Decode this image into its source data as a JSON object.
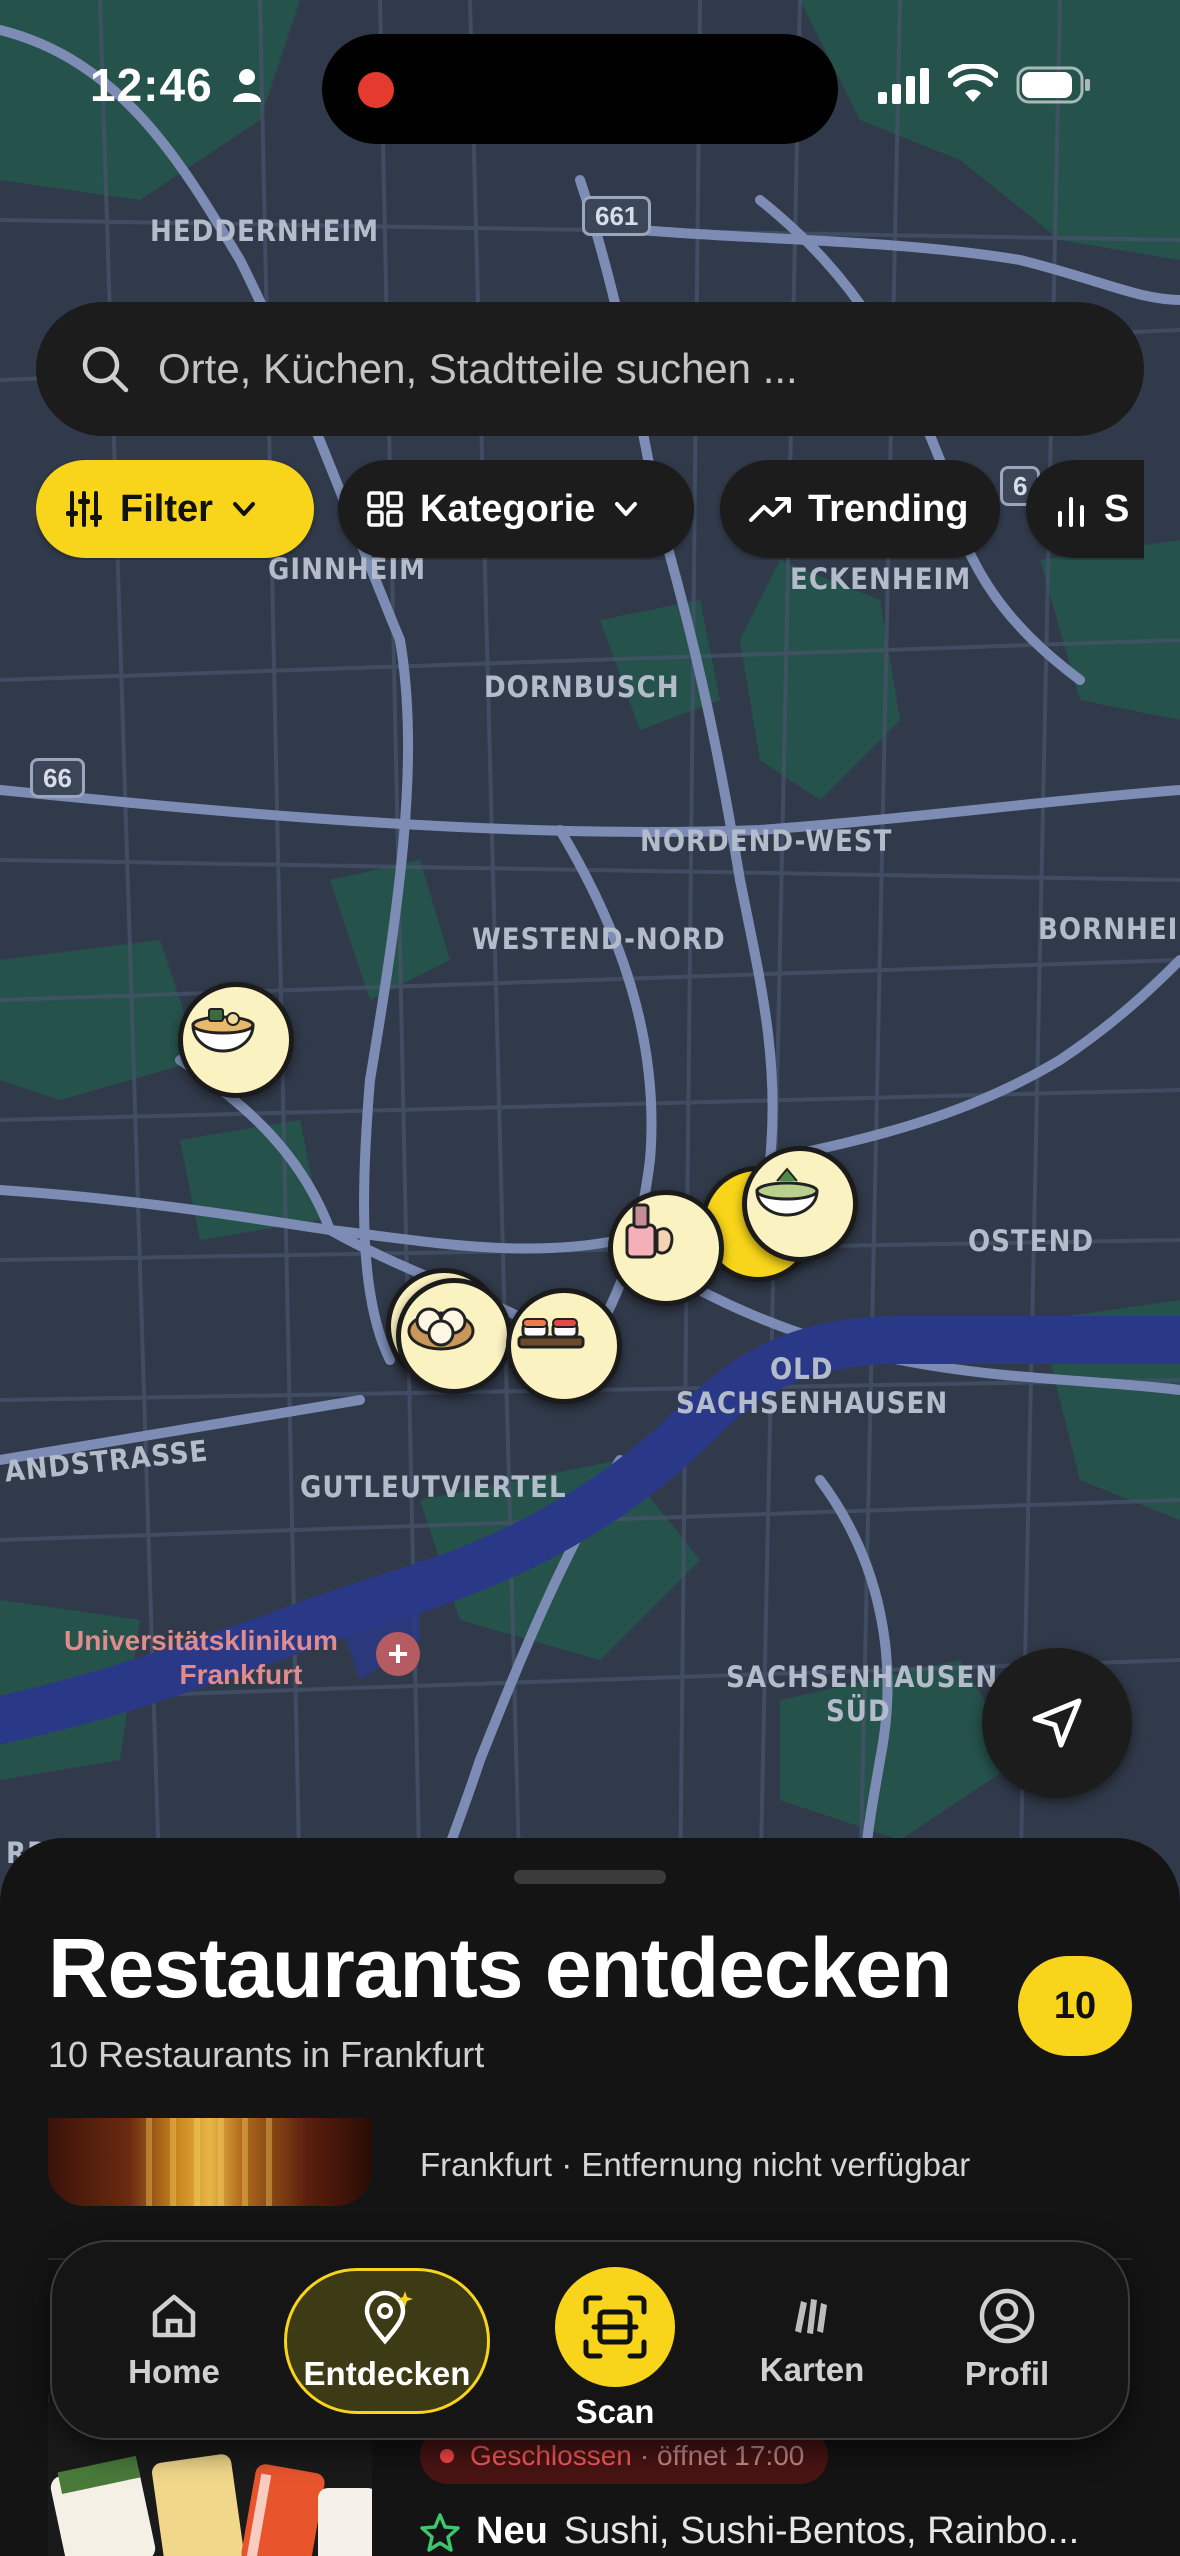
{
  "status_bar": {
    "time": "12:46"
  },
  "map": {
    "road_shields": [
      "661",
      "66",
      "6"
    ],
    "districts": [
      "HEDDERNHEIM",
      "GINNHEIM",
      "ECKENHEIM",
      "DORNBUSCH",
      "NORDEND-WEST",
      "WESTEND-NORD",
      "BORNHEIM",
      "OSTEND",
      "OLD",
      "SACHSENHAUSEN",
      "GUTLEUTVIERTEL",
      "SACHSENHAUSEN-",
      "SÜD",
      "ANDSTRASSE",
      "RR"
    ],
    "clinic_label_1": "Universitätsklinikum",
    "clinic_label_2": "Frankfurt",
    "pins": [
      "ramen-pin-icon",
      "nail-polish-pin-icon",
      "noodle-bowl-pin-icon",
      "dumpling-basket-pin-icon",
      "sushi-pin-icon"
    ]
  },
  "search": {
    "placeholder": "Orte, Küchen, Stadtteile suchen ..."
  },
  "chips": {
    "filter": "Filter",
    "kategorie": "Kategorie",
    "trending": "Trending",
    "sort": "S"
  },
  "sheet": {
    "title": "Restaurants entdecken",
    "subtitle": "10 Restaurants in Frankfurt",
    "count": "10",
    "card1": {
      "meta": "Frankfurt · Entfernung nicht verfügbar"
    },
    "card2": {
      "status": "Geschlossen",
      "status_sub": "· öffnet 17:00",
      "badge": "Neu",
      "tags": "Sushi, Sushi-Bentos, Rainbo..."
    }
  },
  "tabbar": {
    "home": "Home",
    "entdecken": "Entdecken",
    "scan": "Scan",
    "karten": "Karten",
    "profil": "Profil"
  },
  "colors": {
    "accent": "#f8d51a",
    "map_bg": "#313a4a",
    "sheet_bg": "#141414",
    "closed": "#ff5a5a"
  }
}
